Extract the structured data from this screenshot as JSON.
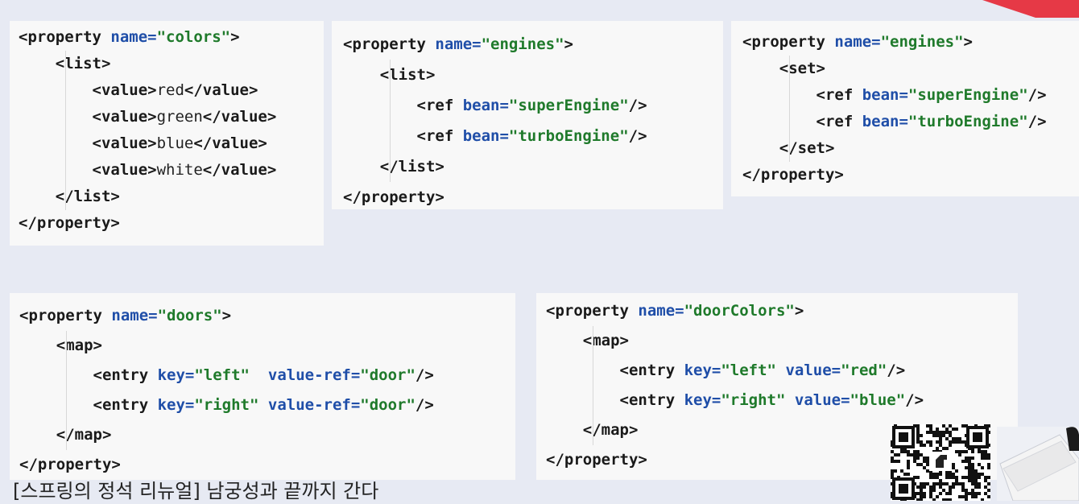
{
  "panels": {
    "colors": {
      "lines": [
        [
          [
            "tag",
            "<property "
          ],
          [
            "attr",
            "name="
          ],
          [
            "str",
            "\"colors\""
          ],
          [
            "tag",
            ">"
          ]
        ],
        [
          [
            "tag",
            "    <list>"
          ]
        ],
        [
          [
            "tag",
            "        <value>"
          ],
          [
            "txt",
            "red"
          ],
          [
            "tag",
            "</value>"
          ]
        ],
        [
          [
            "tag",
            "        <value>"
          ],
          [
            "txt",
            "green"
          ],
          [
            "tag",
            "</value>"
          ]
        ],
        [
          [
            "tag",
            "        <value>"
          ],
          [
            "txt",
            "blue"
          ],
          [
            "tag",
            "</value>"
          ]
        ],
        [
          [
            "tag",
            "        <value>"
          ],
          [
            "txt",
            "white"
          ],
          [
            "tag",
            "</value>"
          ]
        ],
        [
          [
            "tag",
            "    </list>"
          ]
        ],
        [
          [
            "tag",
            "</property>"
          ]
        ]
      ]
    },
    "engines_list": {
      "lines": [
        [
          [
            "tag",
            "<property "
          ],
          [
            "attr",
            "name="
          ],
          [
            "str",
            "\"engines\""
          ],
          [
            "tag",
            ">"
          ]
        ],
        [
          [
            "tag",
            "    <list>"
          ]
        ],
        [
          [
            "tag",
            "        <ref "
          ],
          [
            "attr",
            "bean="
          ],
          [
            "str",
            "\"superEngine\""
          ],
          [
            "tag",
            "/>"
          ]
        ],
        [
          [
            "tag",
            "        <ref "
          ],
          [
            "attr",
            "bean="
          ],
          [
            "str",
            "\"turboEngine\""
          ],
          [
            "tag",
            "/>"
          ]
        ],
        [
          [
            "tag",
            "    </list>"
          ]
        ],
        [
          [
            "tag",
            "</property>"
          ]
        ]
      ]
    },
    "engines_set": {
      "lines": [
        [
          [
            "tag",
            "<property "
          ],
          [
            "attr",
            "name="
          ],
          [
            "str",
            "\"engines\""
          ],
          [
            "tag",
            ">"
          ]
        ],
        [
          [
            "tag",
            "    <set>"
          ]
        ],
        [
          [
            "tag",
            "        <ref "
          ],
          [
            "attr",
            "bean="
          ],
          [
            "str",
            "\"superEngine\""
          ],
          [
            "tag",
            "/>"
          ]
        ],
        [
          [
            "tag",
            "        <ref "
          ],
          [
            "attr",
            "bean="
          ],
          [
            "str",
            "\"turboEngine\""
          ],
          [
            "tag",
            "/>"
          ]
        ],
        [
          [
            "tag",
            "    </set>"
          ]
        ],
        [
          [
            "tag",
            "</property>"
          ]
        ]
      ]
    },
    "doors": {
      "lines": [
        [
          [
            "tag",
            "<property "
          ],
          [
            "attr",
            "name="
          ],
          [
            "str",
            "\"doors\""
          ],
          [
            "tag",
            ">"
          ]
        ],
        [
          [
            "tag",
            "    <map>"
          ]
        ],
        [
          [
            "tag",
            "        <entry "
          ],
          [
            "attr",
            "key="
          ],
          [
            "str",
            "\"left\""
          ],
          [
            "tag",
            "  "
          ],
          [
            "attr",
            "value-ref="
          ],
          [
            "str",
            "\"door\""
          ],
          [
            "tag",
            "/>"
          ]
        ],
        [
          [
            "tag",
            "        <entry "
          ],
          [
            "attr",
            "key="
          ],
          [
            "str",
            "\"right\""
          ],
          [
            "tag",
            " "
          ],
          [
            "attr",
            "value-ref="
          ],
          [
            "str",
            "\"door\""
          ],
          [
            "tag",
            "/>"
          ]
        ],
        [
          [
            "tag",
            "    </map>"
          ]
        ],
        [
          [
            "tag",
            "</property>"
          ]
        ]
      ]
    },
    "doorColors": {
      "lines": [
        [
          [
            "tag",
            "<property "
          ],
          [
            "attr",
            "name="
          ],
          [
            "str",
            "\"doorColors\""
          ],
          [
            "tag",
            ">"
          ]
        ],
        [
          [
            "tag",
            "    <map>"
          ]
        ],
        [
          [
            "tag",
            "        <entry "
          ],
          [
            "attr",
            "key="
          ],
          [
            "str",
            "\"left\""
          ],
          [
            "tag",
            " "
          ],
          [
            "attr",
            "value="
          ],
          [
            "str",
            "\"red\""
          ],
          [
            "tag",
            "/>"
          ]
        ],
        [
          [
            "tag",
            "        <entry "
          ],
          [
            "attr",
            "key="
          ],
          [
            "str",
            "\"right\""
          ],
          [
            "tag",
            " "
          ],
          [
            "attr",
            "value="
          ],
          [
            "str",
            "\"blue\""
          ],
          [
            "tag",
            "/>"
          ]
        ],
        [
          [
            "tag",
            "    </map>"
          ]
        ],
        [
          [
            "tag",
            "</property>"
          ]
        ]
      ]
    }
  },
  "caption": "[스프링의 정석 리뉴얼] 남궁성과 끝까지 간다",
  "colors": {
    "background": "#e7eaf3",
    "panel": "#f8f8f8",
    "tag": "#1a1a1a",
    "attr": "#1f4ea8",
    "string": "#1f7a2b",
    "accent": "#e63946"
  }
}
